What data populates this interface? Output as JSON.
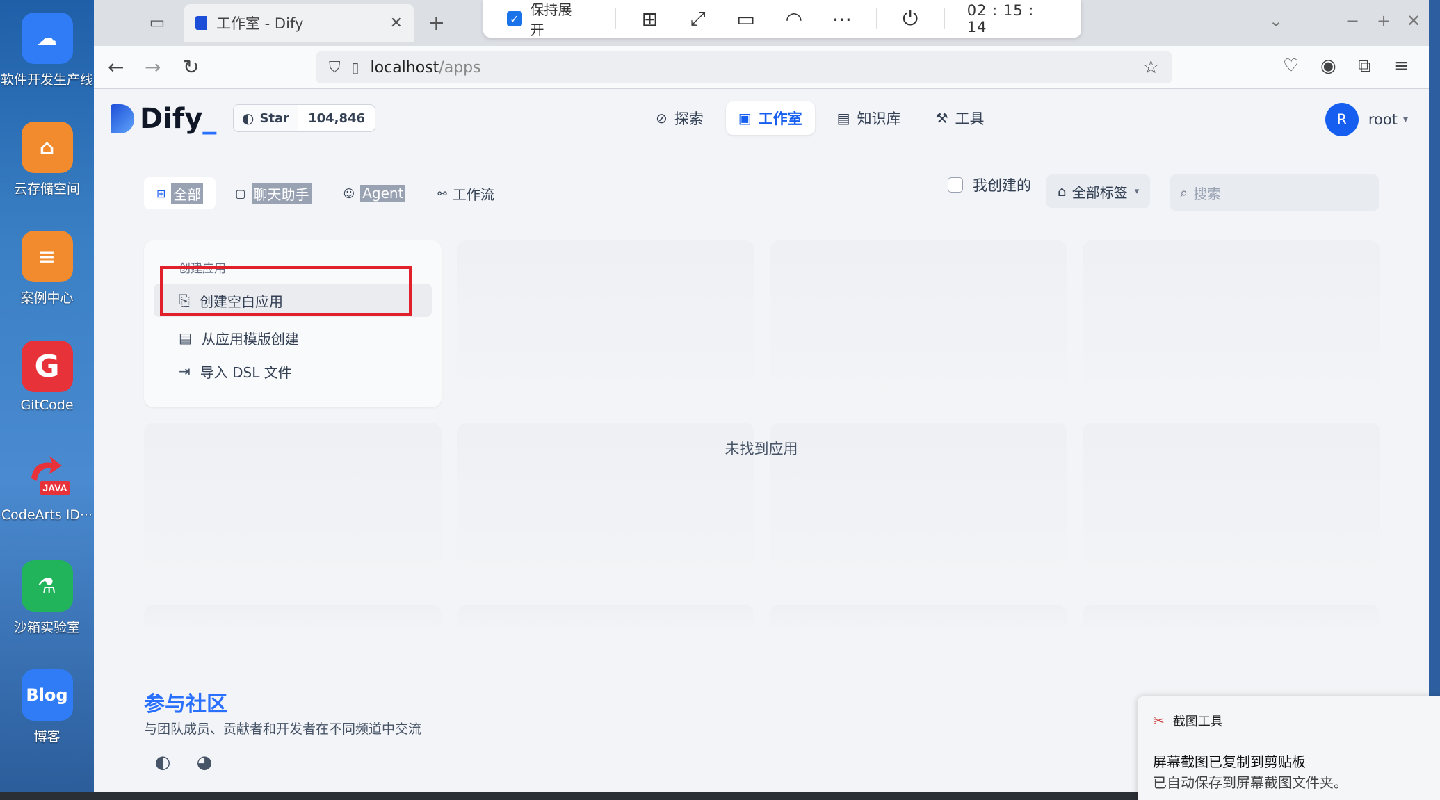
{
  "desktop": {
    "items": [
      {
        "label": "软件开发生产线",
        "icon": "cloud-devops-icon",
        "color": "#2f7cf6",
        "glyph": "☁"
      },
      {
        "label": "云存储空间",
        "icon": "cloud-storage-icon",
        "color": "#f28a2e",
        "glyph": "⌂"
      },
      {
        "label": "案例中心",
        "icon": "case-center-icon",
        "color": "#f28a2e",
        "glyph": "≡"
      },
      {
        "label": "GitCode",
        "icon": "gitcode-icon",
        "color": "#e8323a",
        "glyph": "G"
      },
      {
        "label": "CodeArts ID···",
        "icon": "codearts-java-icon",
        "color": "#ffffff",
        "glyph": "JAVA"
      },
      {
        "label": "沙箱实验室",
        "icon": "sandbox-lab-icon",
        "color": "#22b45a",
        "glyph": "⚗"
      },
      {
        "label": "博客",
        "icon": "blog-icon",
        "color": "#2f7cf6",
        "glyph": "Blog"
      }
    ]
  },
  "browser": {
    "tab_title": "工作室 - Dify",
    "url_host": "localhost",
    "url_path": "/apps"
  },
  "remote_toolbar": {
    "keep_expanded_label": "保持展开",
    "time": "02 : 15 : 14"
  },
  "app": {
    "brand": "Dify",
    "github": {
      "star_label": "Star",
      "star_count": "104,846"
    },
    "nav": [
      {
        "label": "探索",
        "icon": "compass-icon"
      },
      {
        "label": "工作室",
        "icon": "robot-icon",
        "active": true
      },
      {
        "label": "知识库",
        "icon": "book-icon"
      },
      {
        "label": "工具",
        "icon": "hammer-icon"
      }
    ],
    "user": {
      "initial": "R",
      "name": "root"
    },
    "filter_tabs": [
      {
        "label": "全部",
        "icon": "grid-icon",
        "active": true
      },
      {
        "label": "聊天助手",
        "icon": "chat-icon"
      },
      {
        "label": "Agent",
        "icon": "agent-icon"
      },
      {
        "label": "工作流",
        "icon": "workflow-icon"
      }
    ],
    "my_created_label": "我创建的",
    "tag_filter_label": "全部标签",
    "search_placeholder": "搜索",
    "create_card": {
      "header": "创建应用",
      "items": [
        {
          "label": "创建空白应用",
          "icon": "blank-app-icon"
        },
        {
          "label": "从应用模版创建",
          "icon": "template-icon"
        },
        {
          "label": "导入 DSL 文件",
          "icon": "import-icon"
        }
      ]
    },
    "empty_message": "未找到应用",
    "community": {
      "title": "参与社区",
      "subtitle": "与团队成员、贡献者和开发者在不同频道中交流"
    }
  },
  "toast": {
    "app": "截图工具",
    "title": "屏幕截图已复制到剪贴板",
    "subtitle": "已自动保存到屏幕截图文件夹。"
  }
}
